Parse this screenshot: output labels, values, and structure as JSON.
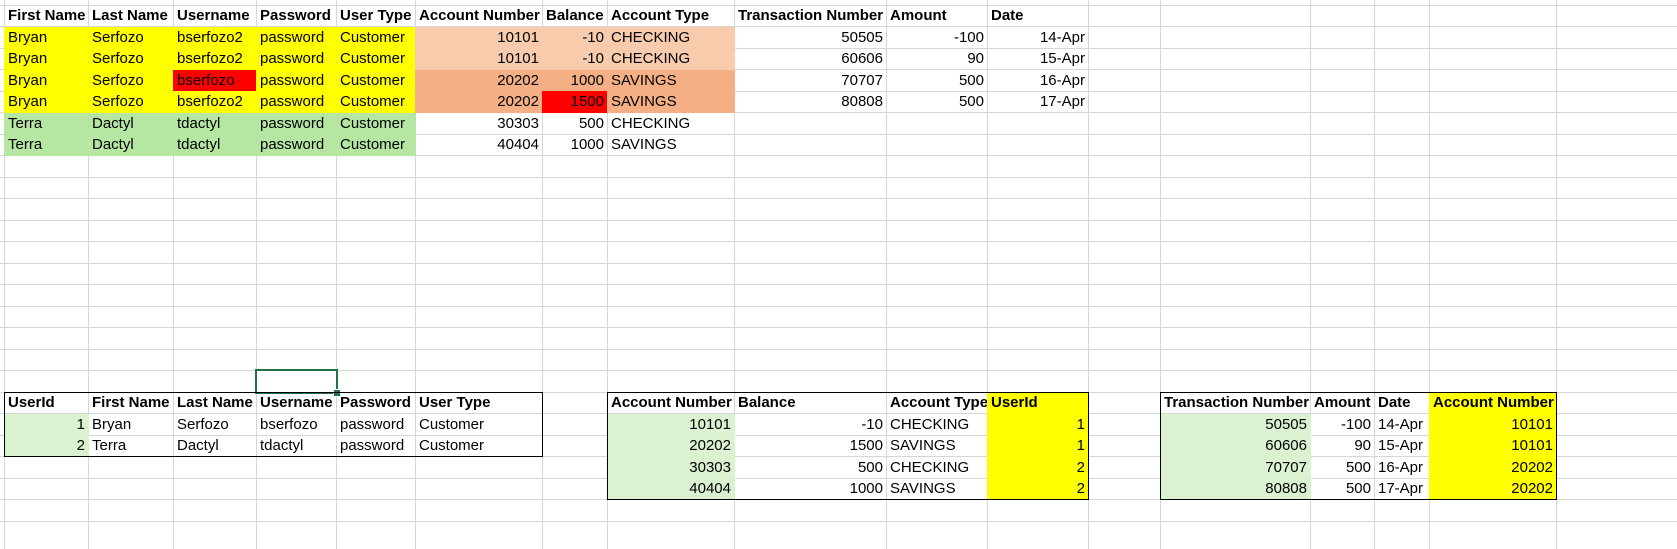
{
  "colors": {
    "yellow": "#ffff00",
    "green_row": "#b5e6a2",
    "peach_light": "#f8cbad",
    "peach_dark": "#f4b084",
    "red": "#ff0000",
    "light_green": "#daf2d0",
    "gridline": "#d6d6d6",
    "selection": "#217346"
  },
  "top_users": {
    "headers": [
      "First Name",
      "Last Name",
      "Username",
      "Password",
      "User Type"
    ],
    "rows": [
      [
        "Bryan",
        "Serfozo",
        "bserfozo2",
        "password",
        "Customer"
      ],
      [
        "Bryan",
        "Serfozo",
        "bserfozo2",
        "password",
        "Customer"
      ],
      [
        "Bryan",
        "Serfozo",
        "bserfozo",
        "password",
        "Customer"
      ],
      [
        "Bryan",
        "Serfozo",
        "bserfozo2",
        "password",
        "Customer"
      ],
      [
        "Terra",
        "Dactyl",
        "tdactyl",
        "password",
        "Customer"
      ],
      [
        "Terra",
        "Dactyl",
        "tdactyl",
        "password",
        "Customer"
      ]
    ]
  },
  "top_accounts": {
    "headers": [
      "Account Number",
      "Balance",
      "Account Type"
    ],
    "rows": [
      [
        "10101",
        "-10",
        "CHECKING"
      ],
      [
        "10101",
        "-10",
        "CHECKING"
      ],
      [
        "20202",
        "1000",
        "SAVINGS"
      ],
      [
        "20202",
        "1500",
        "SAVINGS"
      ],
      [
        "30303",
        "500",
        "CHECKING"
      ],
      [
        "40404",
        "1000",
        "SAVINGS"
      ]
    ]
  },
  "top_transactions": {
    "headers": [
      "Transaction Number",
      "Amount",
      "Date"
    ],
    "rows": [
      [
        "50505",
        "-100",
        "14-Apr"
      ],
      [
        "60606",
        "90",
        "15-Apr"
      ],
      [
        "70707",
        "500",
        "16-Apr"
      ],
      [
        "80808",
        "500",
        "17-Apr"
      ]
    ]
  },
  "users_table": {
    "headers": [
      "UserId",
      "First Name",
      "Last Name",
      "Username",
      "Password",
      "User Type"
    ],
    "rows": [
      [
        "1",
        "Bryan",
        "Serfozo",
        "bserfozo",
        "password",
        "Customer"
      ],
      [
        "2",
        "Terra",
        "Dactyl",
        "tdactyl",
        "password",
        "Customer"
      ]
    ]
  },
  "accounts_table": {
    "headers": [
      "Account Number",
      "Balance",
      "Account Type",
      "UserId"
    ],
    "rows": [
      [
        "10101",
        "-10",
        "CHECKING",
        "1"
      ],
      [
        "20202",
        "1500",
        "SAVINGS",
        "1"
      ],
      [
        "30303",
        "500",
        "CHECKING",
        "2"
      ],
      [
        "40404",
        "1000",
        "SAVINGS",
        "2"
      ]
    ]
  },
  "transactions_table": {
    "headers": [
      "Transaction Number",
      "Amount",
      "Date",
      "Account Number"
    ],
    "rows": [
      [
        "50505",
        "-100",
        "14-Apr",
        "10101"
      ],
      [
        "60606",
        "90",
        "15-Apr",
        "10101"
      ],
      [
        "70707",
        "500",
        "16-Apr",
        "20202"
      ],
      [
        "80808",
        "500",
        "17-Apr",
        "20202"
      ]
    ]
  }
}
